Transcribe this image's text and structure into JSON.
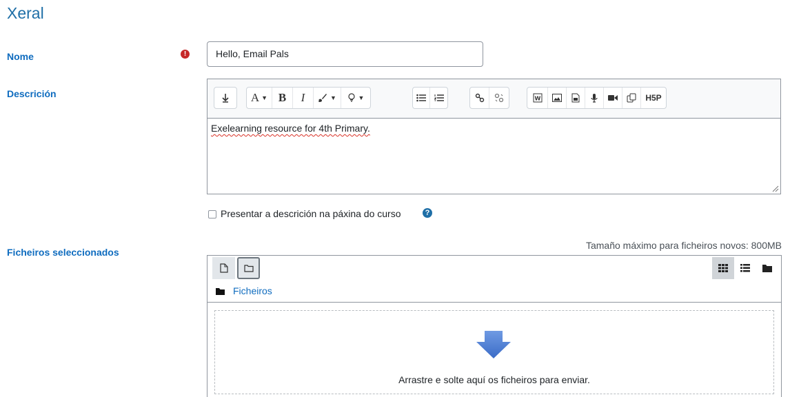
{
  "section": {
    "title": "Xeral"
  },
  "fields": {
    "name_label": "Nome",
    "name_value": "Hello, Email Pals",
    "description_label": "Descrición",
    "description_text": "Exelearning resource for 4th Primary.",
    "files_label": "Ficheiros seleccionados"
  },
  "toolbar": {
    "bold": "B",
    "italic": "I",
    "font_color": "A",
    "h5p": "H5P"
  },
  "checkbox": {
    "label": "Presentar a descrición na páxina do curso",
    "checked": false
  },
  "filemanager": {
    "max_size": "Tamaño máximo para ficheiros novos: 800MB",
    "breadcrumb": "Ficheiros",
    "drop_text": "Arrastre e solte aquí os ficheiros para enviar."
  },
  "colors": {
    "accent": "#0f6cbf",
    "required": "#c62828",
    "drop_arrow": "#4a7bd1"
  }
}
